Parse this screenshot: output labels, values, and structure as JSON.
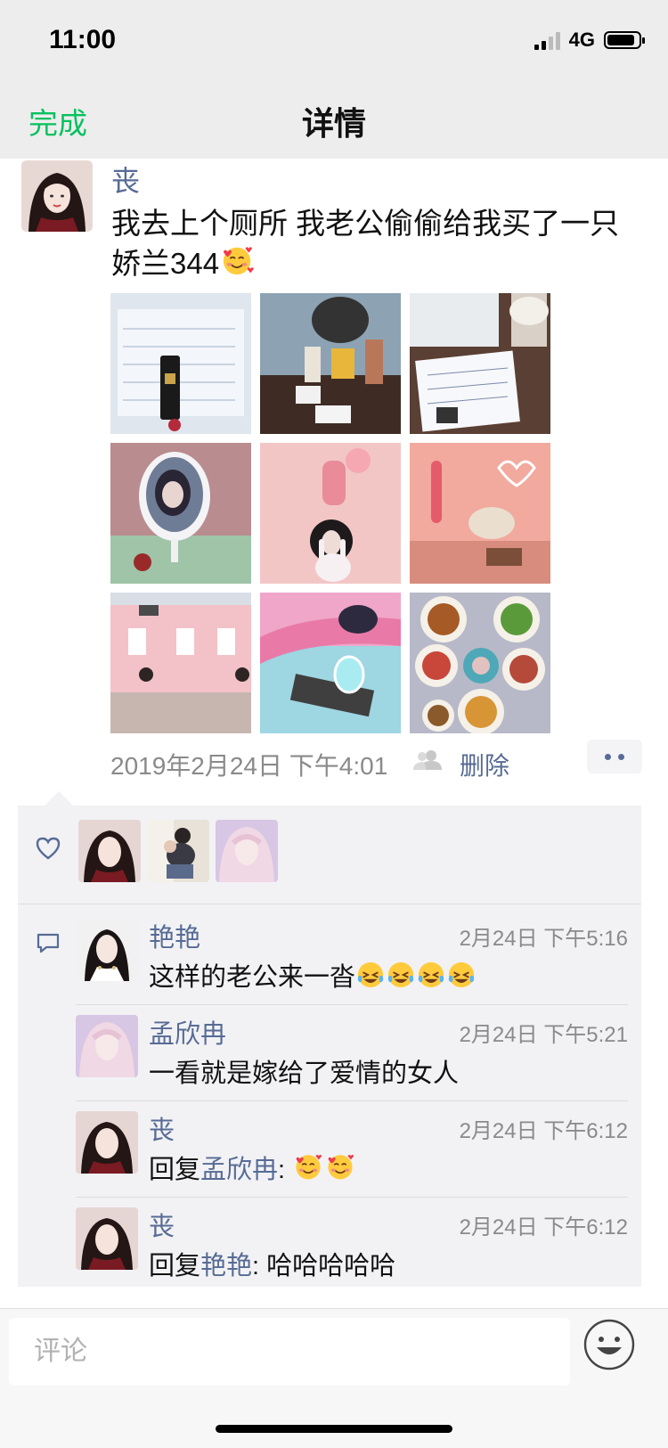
{
  "status_bar": {
    "time": "11:00",
    "network": "4G"
  },
  "nav": {
    "done_label": "完成",
    "title": "详情"
  },
  "post": {
    "author_name": "丧",
    "text": "我去上个厕所 我老公偷偷给我买了一只娇兰344",
    "time": "2019年2月24日 下午4:01",
    "delete_label": "删除",
    "photo_count": 9
  },
  "likes": {
    "avatars": [
      "丧",
      "user-2",
      "孟欣冉"
    ]
  },
  "comments": [
    {
      "name": "艳艳",
      "time": "2月24日 下午5:16",
      "text": "这样的老公来一沓",
      "emoji_count": 4,
      "emoji": "crying-laughing-emoji"
    },
    {
      "name": "孟欣冉",
      "time": "2月24日 下午5:21",
      "text": "一看就是嫁给了爱情的女人"
    },
    {
      "name": "丧",
      "time": "2月24日 下午6:12",
      "reply_prefix": "回复",
      "reply_to": "孟欣冉",
      "text": ": ",
      "emoji_count": 2,
      "emoji": "smiling-face-with-hearts-emoji"
    },
    {
      "name": "丧",
      "time": "2月24日 下午6:12",
      "reply_prefix": "回复",
      "reply_to": "艳艳",
      "text": ": 哈哈哈哈哈"
    }
  ],
  "input": {
    "placeholder": "评论"
  },
  "colors": {
    "accent_green": "#07c160",
    "link_blue": "#576b95"
  }
}
